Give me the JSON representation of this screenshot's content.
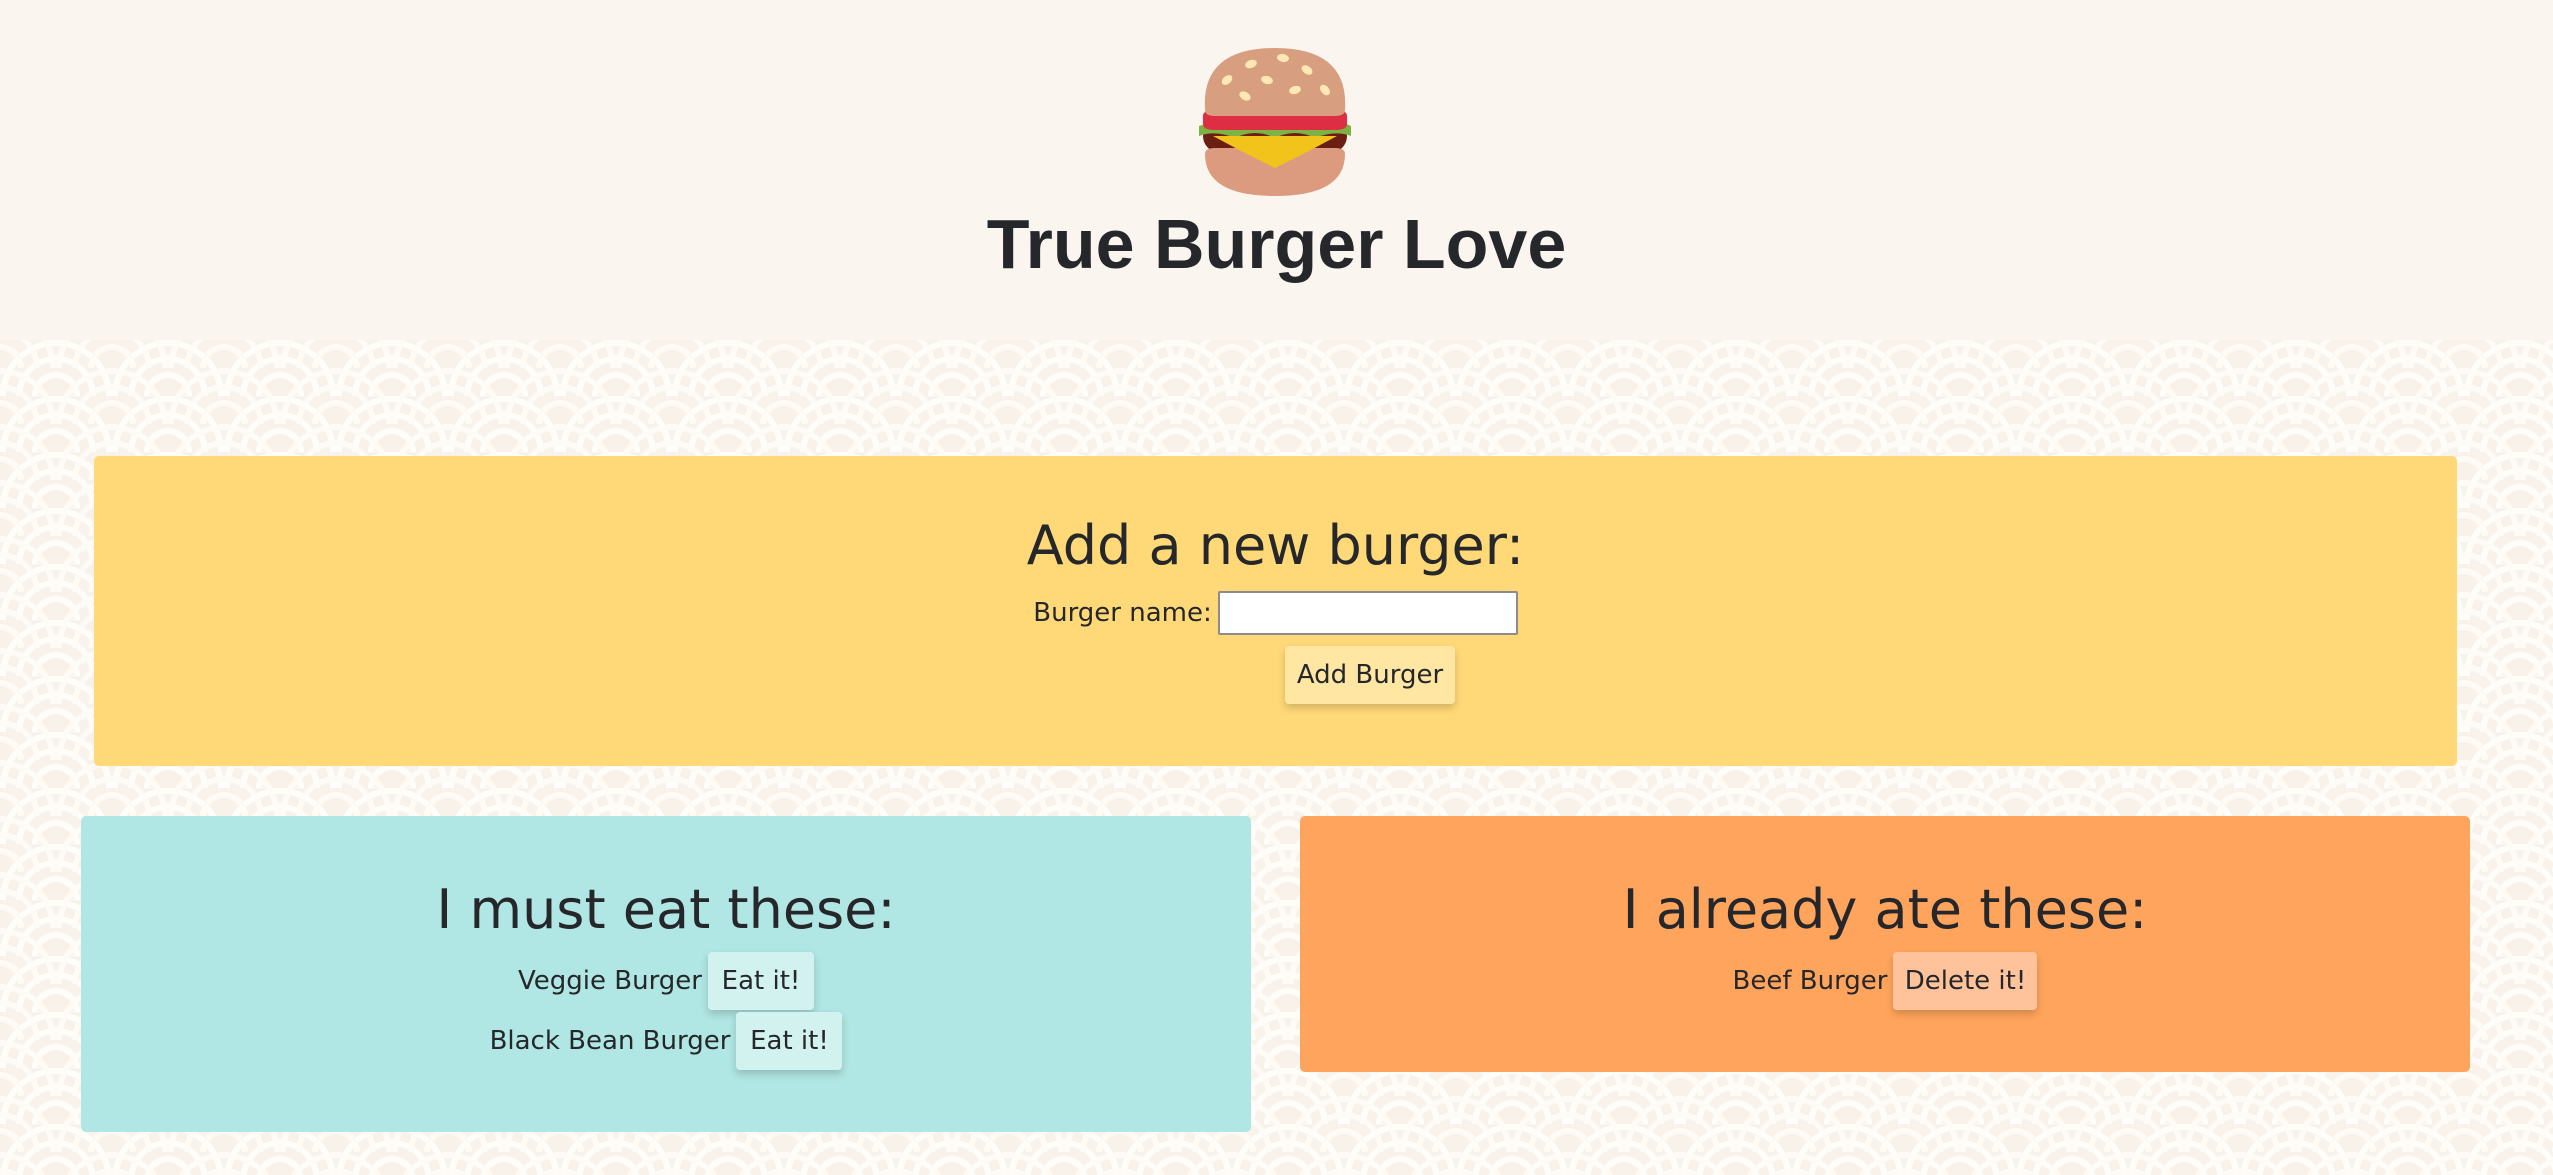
{
  "header": {
    "title": "True Burger Love",
    "logo_icon": "hamburger-icon"
  },
  "add_form": {
    "heading": "Add a new burger:",
    "name_label": "Burger name:",
    "name_value": "",
    "submit_label": "Add Burger"
  },
  "to_eat": {
    "heading": "I must eat these:",
    "items": [
      {
        "name": "Veggie Burger",
        "action": "Eat it!"
      },
      {
        "name": "Black Bean Burger",
        "action": "Eat it!"
      }
    ]
  },
  "eaten": {
    "heading": "I already ate these:",
    "items": [
      {
        "name": "Beef Burger",
        "action": "Delete it!"
      }
    ]
  },
  "colors": {
    "page_background": "#faf5ef",
    "add_panel": "#ffd978",
    "to_eat_panel": "#b0e6e3",
    "eaten_panel": "#ffa45c"
  }
}
